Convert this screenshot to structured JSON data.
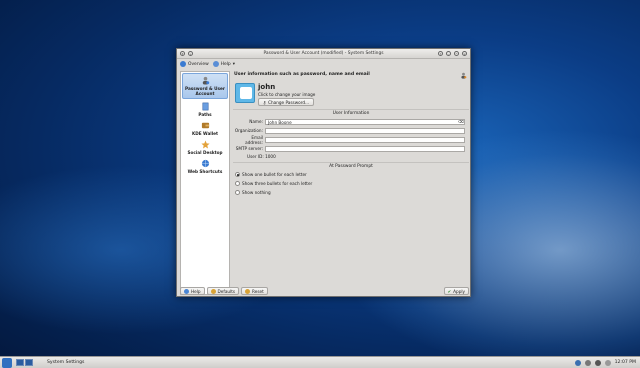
{
  "window": {
    "title": "Password & User Account (modified) - System Settings"
  },
  "toolbar": {
    "overview_label": "Overview",
    "help_label": "Help"
  },
  "sidebar": {
    "items": [
      {
        "label": "Password & User Account",
        "icon": "user-account-icon",
        "active": true
      },
      {
        "label": "Paths",
        "icon": "paths-icon",
        "active": false
      },
      {
        "label": "KDE Wallet",
        "icon": "wallet-icon",
        "active": false
      },
      {
        "label": "Social Desktop",
        "icon": "social-desktop-icon",
        "active": false
      },
      {
        "label": "Web Shortcuts",
        "icon": "web-shortcuts-icon",
        "active": false
      }
    ]
  },
  "content": {
    "heading": "User information such as password, name and email",
    "username": "john",
    "click_to_change": "Click to change your image",
    "change_password_label": "Change Password...",
    "user_info_title": "User Information",
    "fields": {
      "name_label": "Name:",
      "name_value": "John Boone",
      "organization_label": "Organization:",
      "organization_value": "",
      "email_label": "Email address:",
      "email_value": "",
      "smtp_label": "SMTP server:",
      "smtp_value": "",
      "userid_text": "User ID: 1000"
    },
    "prompt_title": "At Password Prompt",
    "prompt_options": [
      {
        "label": "Show one bullet for each letter",
        "selected": true
      },
      {
        "label": "Show three bullets for each letter",
        "selected": false
      },
      {
        "label": "Show nothing",
        "selected": false
      }
    ]
  },
  "buttons": {
    "help": "Help",
    "defaults": "Defaults",
    "reset": "Reset",
    "apply": "Apply"
  },
  "panel": {
    "task": "System Settings",
    "clock": "12:07 PM"
  },
  "colors": {
    "accent": "#7ba6db",
    "desktop_blue": "#0b3d86"
  }
}
